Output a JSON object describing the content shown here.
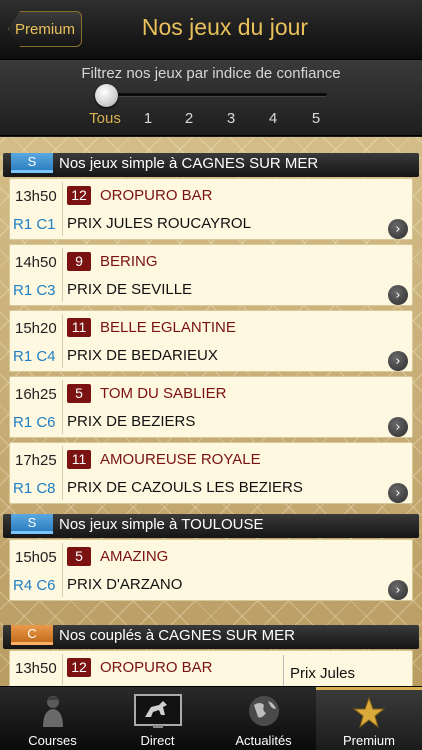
{
  "header": {
    "back_label": "Premium",
    "title": "Nos jeux du jour"
  },
  "filter": {
    "label": "Filtrez nos jeux par indice de confiance",
    "options": [
      "Tous",
      "1",
      "2",
      "3",
      "4",
      "5"
    ],
    "selected": "Tous"
  },
  "sections": [
    {
      "badge": "S",
      "title": "Nos jeux simple à CAGNES SUR MER",
      "items": [
        {
          "time": "13h50",
          "race": "R1 C1",
          "number": "12",
          "horse": "OROPURO BAR",
          "prix": "PRIX JULES ROUCAYROL"
        },
        {
          "time": "14h50",
          "race": "R1 C3",
          "number": "9",
          "horse": "BERING",
          "prix": "PRIX DE SEVILLE"
        },
        {
          "time": "15h20",
          "race": "R1 C4",
          "number": "11",
          "horse": "BELLE EGLANTINE",
          "prix": "PRIX DE BEDARIEUX"
        },
        {
          "time": "16h25",
          "race": "R1 C6",
          "number": "5",
          "horse": "TOM DU SABLIER",
          "prix": "PRIX DE BEZIERS"
        },
        {
          "time": "17h25",
          "race": "R1 C8",
          "number": "11",
          "horse": "AMOUREUSE ROYALE",
          "prix": "PRIX DE CAZOULS LES BEZIERS"
        }
      ]
    },
    {
      "badge": "S",
      "title": "Nos jeux simple à TOULOUSE",
      "items": [
        {
          "time": "15h05",
          "race": "R4 C6",
          "number": "5",
          "horse": "AMAZING",
          "prix": "PRIX D'ARZANO"
        }
      ]
    },
    {
      "badge": "C",
      "title": "Nos couplés à CAGNES SUR MER",
      "items": [
        {
          "time": "13h50",
          "number": "12",
          "horse": "OROPURO BAR",
          "note": "Prix Jules"
        }
      ]
    }
  ],
  "tabbar": {
    "tabs": [
      {
        "label": "Courses",
        "icon": "jockey-icon"
      },
      {
        "label": "Direct",
        "icon": "tv-horse-icon"
      },
      {
        "label": "Actualités",
        "icon": "globe-icon"
      },
      {
        "label": "Premium",
        "icon": "star-icon"
      }
    ],
    "selected": "Premium"
  },
  "colors": {
    "gold": "#d9b04f",
    "maroon": "#7a1212",
    "blue": "#1f7fc4",
    "simple_badge": "#4a9ad6",
    "couple_badge": "#e08a3a"
  }
}
